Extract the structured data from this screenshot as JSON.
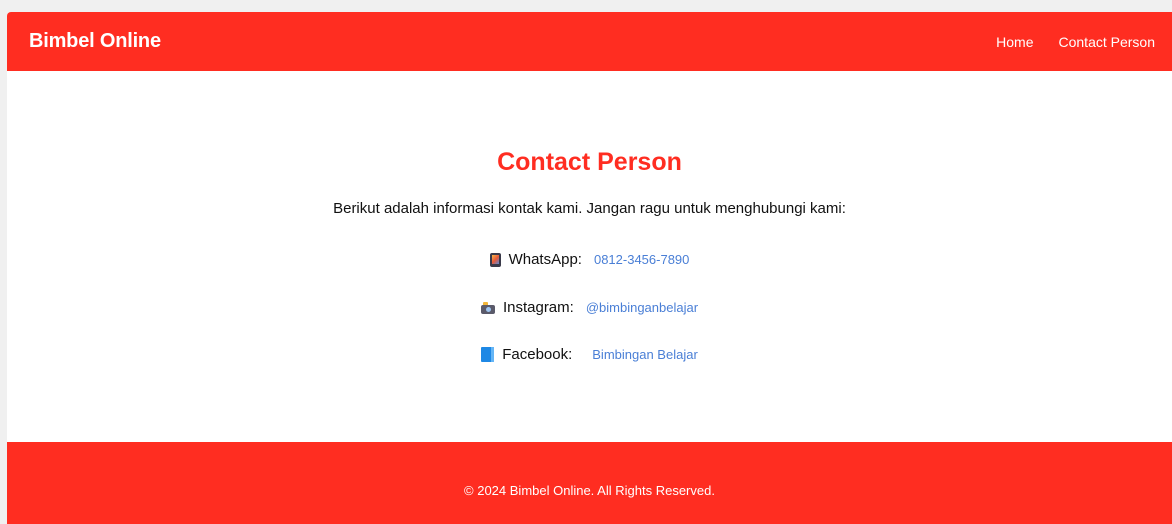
{
  "navbar": {
    "brand": "Bimbel Online",
    "links": [
      {
        "label": "Home"
      },
      {
        "label": "Contact Person"
      }
    ]
  },
  "main": {
    "title": "Contact Person",
    "intro": "Berikut adalah informasi kontak kami. Jangan ragu untuk menghubungi kami:",
    "contacts": [
      {
        "icon": "phone-icon",
        "label": "WhatsApp:",
        "value": "0812-3456-7890"
      },
      {
        "icon": "camera-icon",
        "label": "Instagram:",
        "value": "@bimbinganbelajar"
      },
      {
        "icon": "book-icon",
        "label": "Facebook:",
        "value": "Bimbingan Belajar"
      }
    ]
  },
  "footer": {
    "text": "© 2024 Bimbel Online. All Rights Reserved."
  },
  "colors": {
    "brand_red": "#ff2d21",
    "link_blue": "#4a7fd6",
    "background": "#ffffff"
  }
}
